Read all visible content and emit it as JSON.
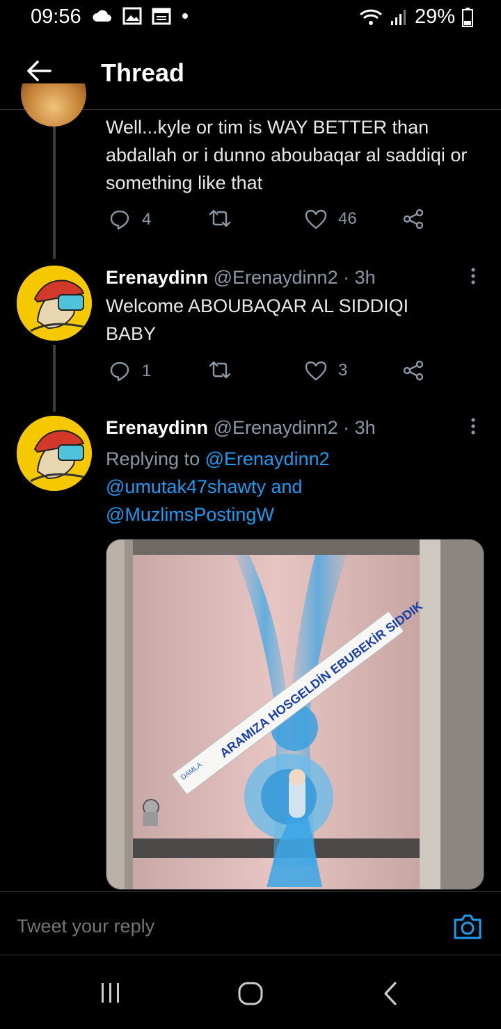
{
  "status_bar": {
    "time": "09:56",
    "battery": "29%"
  },
  "header": {
    "title": "Thread"
  },
  "tweets": [
    {
      "text": "Well...kyle or tim is WAY BETTER than abdallah or i dunno aboubaqar al saddiqi or something like that",
      "replies": "4",
      "retweets": "",
      "likes": "46"
    },
    {
      "name": "Erenaydinn",
      "handle": "@Erenaydinn2 · 3h",
      "text": "Welcome ABOUBAQAR AL SIDDIQI BABY",
      "replies": "1",
      "retweets": "",
      "likes": "3"
    },
    {
      "name": "Erenaydinn",
      "handle": "@Erenaydinn2 · 3h",
      "replying_prefix": "Replying to ",
      "mention_1": "@Erenaydinn2",
      "mention_2": "@umutak47shawty",
      "and_word": " and",
      "mention_3": "@MuzlimsPostingW",
      "banner_text": "ARAMIZA HOSGELDİN EBUBEKİR SIDDIK",
      "banner_small": "DAMLA"
    }
  ],
  "reply_bar": {
    "placeholder": "Tweet your reply"
  },
  "colors": {
    "accent": "#1d9bf0",
    "muted": "#8b98a5",
    "background": "#000000",
    "avatar_bg": "#f5c800"
  }
}
